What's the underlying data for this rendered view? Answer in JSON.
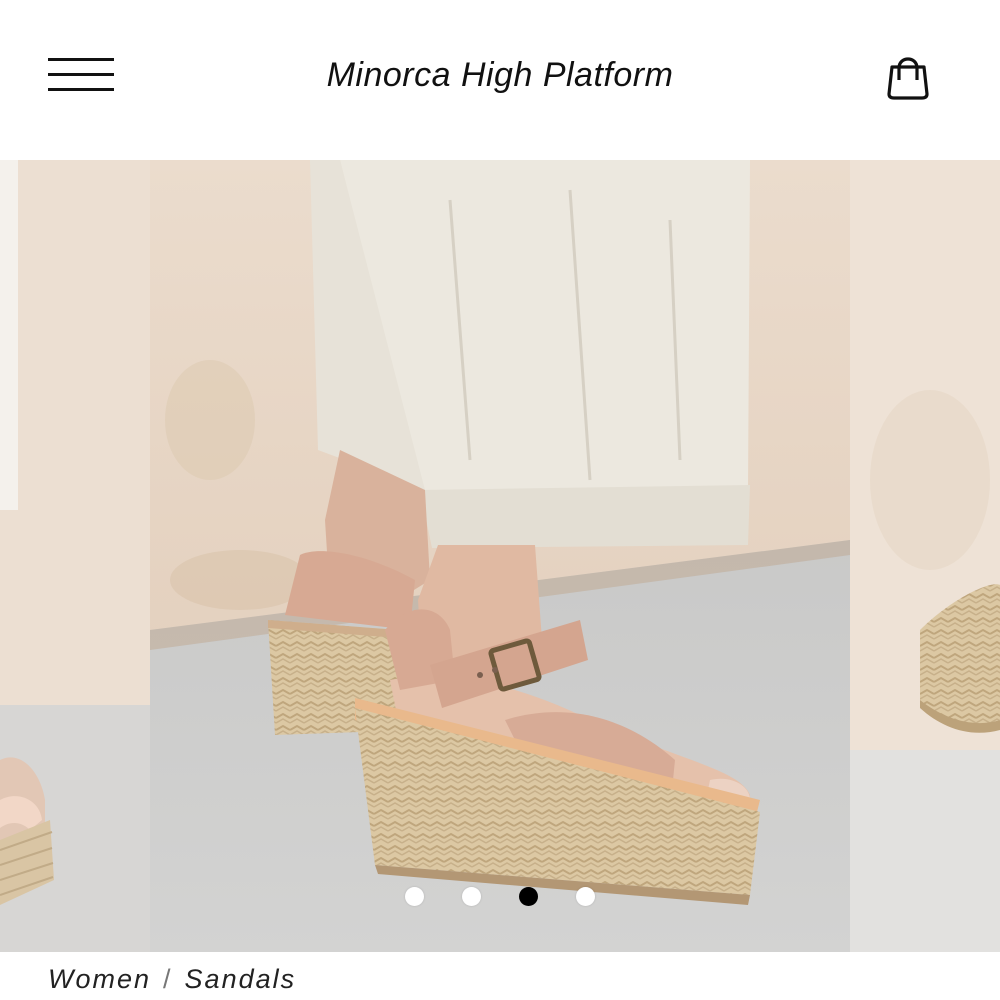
{
  "header": {
    "title": "Minorca High Platform",
    "menu_icon": "hamburger-menu-icon",
    "cart_icon": "shopping-bag-icon"
  },
  "gallery": {
    "slide_count": 4,
    "active_index": 2,
    "colors": {
      "wall": "#ead9c9",
      "ground": "#cfcfce",
      "pants": "#ece8df",
      "leather": "#d9ad98",
      "espadrille": "#d8c39e"
    }
  },
  "breadcrumb": {
    "items": [
      "Women",
      "Sandals"
    ],
    "separator": "/"
  }
}
